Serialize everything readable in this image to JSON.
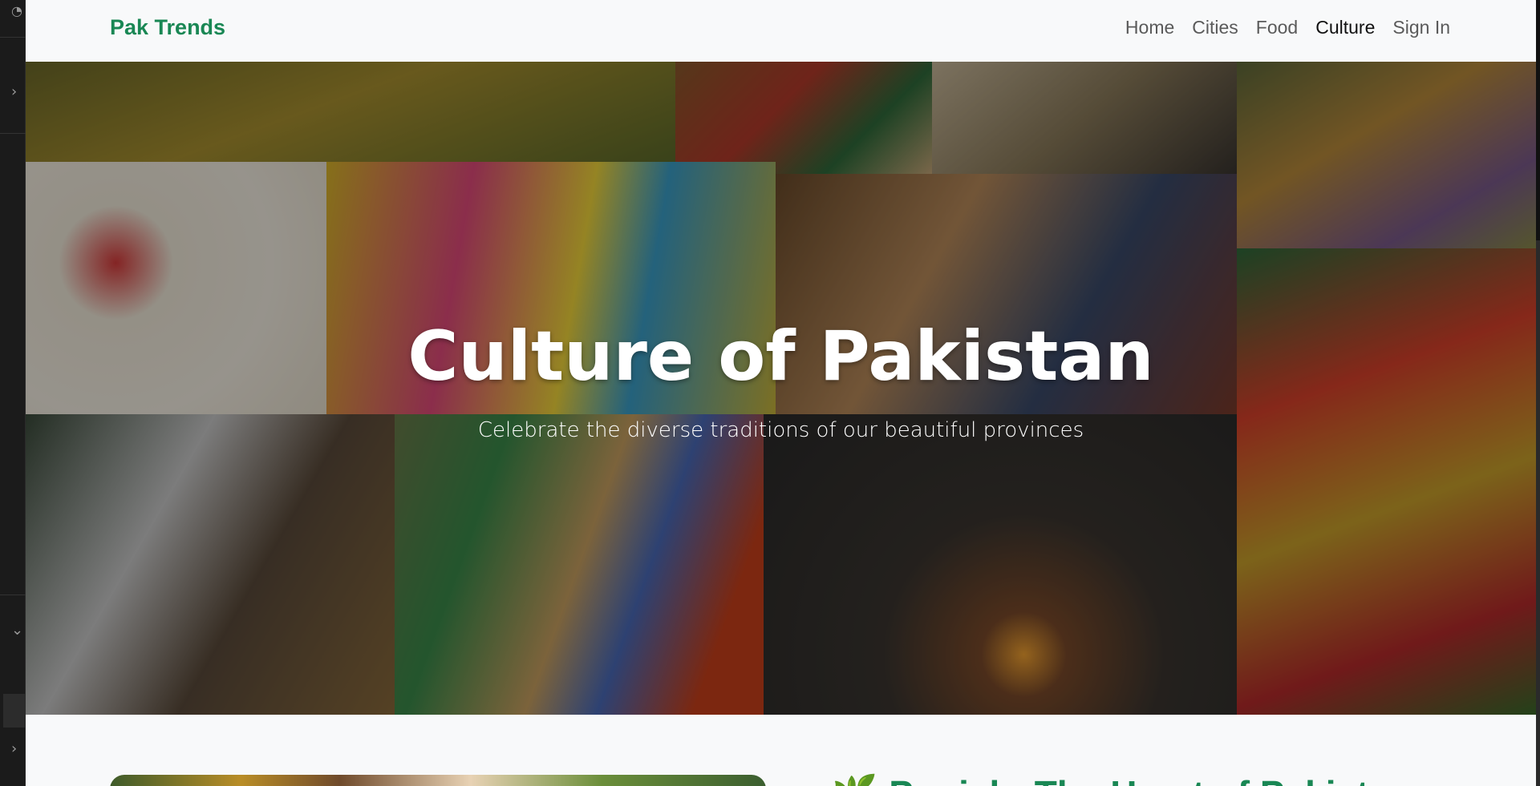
{
  "navbar": {
    "brand": "Pak Trends",
    "links": [
      {
        "label": "Home",
        "active": false
      },
      {
        "label": "Cities",
        "active": false
      },
      {
        "label": "Food",
        "active": false
      },
      {
        "label": "Culture",
        "active": true
      },
      {
        "label": "Sign In",
        "active": false
      }
    ]
  },
  "hero": {
    "title": "Culture of Pakistan",
    "subtitle": "Celebrate the diverse traditions of our beautiful provinces"
  },
  "section": {
    "heading": "Punjab: The Heart of Pakist"
  },
  "editor": {
    "chevron_right": "›",
    "chevron_down": "⌄"
  },
  "colors": {
    "brand_green": "#198754",
    "page_bg": "#f8f9fa"
  }
}
